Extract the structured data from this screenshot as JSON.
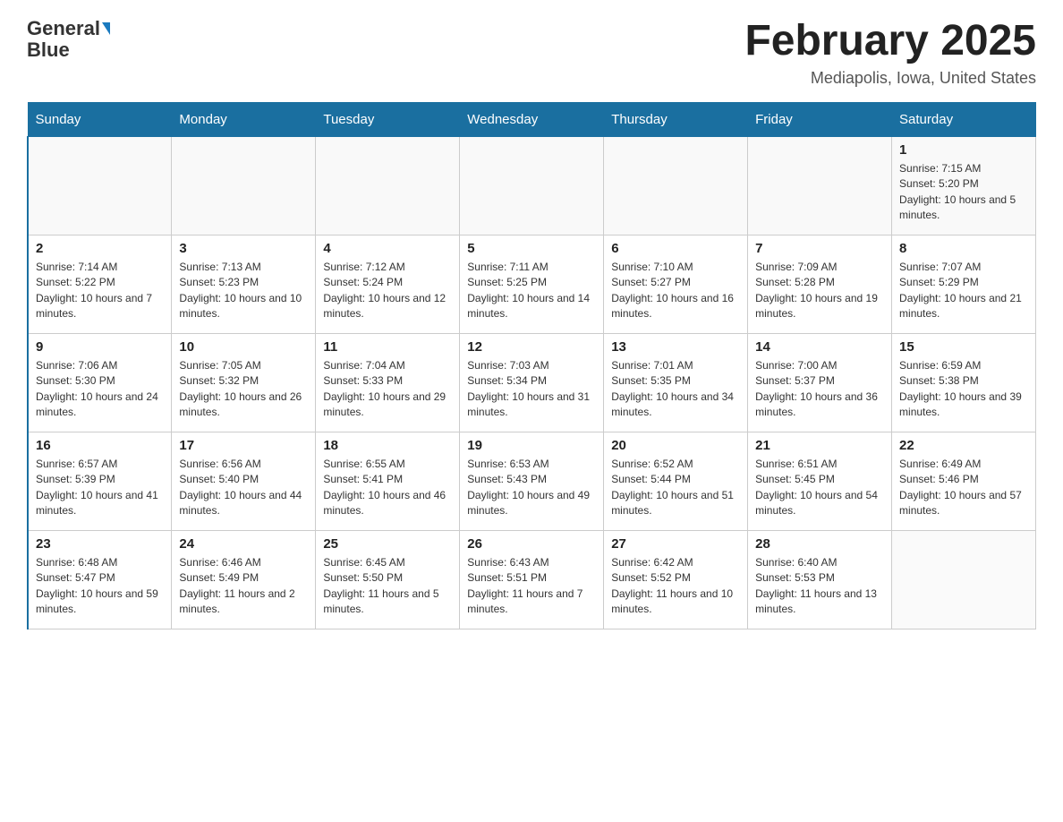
{
  "header": {
    "logo_line1": "General",
    "logo_line2": "Blue",
    "month_title": "February 2025",
    "location": "Mediapolis, Iowa, United States"
  },
  "days_of_week": [
    "Sunday",
    "Monday",
    "Tuesday",
    "Wednesday",
    "Thursday",
    "Friday",
    "Saturday"
  ],
  "weeks": [
    [
      {
        "day": "",
        "info": ""
      },
      {
        "day": "",
        "info": ""
      },
      {
        "day": "",
        "info": ""
      },
      {
        "day": "",
        "info": ""
      },
      {
        "day": "",
        "info": ""
      },
      {
        "day": "",
        "info": ""
      },
      {
        "day": "1",
        "info": "Sunrise: 7:15 AM\nSunset: 5:20 PM\nDaylight: 10 hours and 5 minutes."
      }
    ],
    [
      {
        "day": "2",
        "info": "Sunrise: 7:14 AM\nSunset: 5:22 PM\nDaylight: 10 hours and 7 minutes."
      },
      {
        "day": "3",
        "info": "Sunrise: 7:13 AM\nSunset: 5:23 PM\nDaylight: 10 hours and 10 minutes."
      },
      {
        "day": "4",
        "info": "Sunrise: 7:12 AM\nSunset: 5:24 PM\nDaylight: 10 hours and 12 minutes."
      },
      {
        "day": "5",
        "info": "Sunrise: 7:11 AM\nSunset: 5:25 PM\nDaylight: 10 hours and 14 minutes."
      },
      {
        "day": "6",
        "info": "Sunrise: 7:10 AM\nSunset: 5:27 PM\nDaylight: 10 hours and 16 minutes."
      },
      {
        "day": "7",
        "info": "Sunrise: 7:09 AM\nSunset: 5:28 PM\nDaylight: 10 hours and 19 minutes."
      },
      {
        "day": "8",
        "info": "Sunrise: 7:07 AM\nSunset: 5:29 PM\nDaylight: 10 hours and 21 minutes."
      }
    ],
    [
      {
        "day": "9",
        "info": "Sunrise: 7:06 AM\nSunset: 5:30 PM\nDaylight: 10 hours and 24 minutes."
      },
      {
        "day": "10",
        "info": "Sunrise: 7:05 AM\nSunset: 5:32 PM\nDaylight: 10 hours and 26 minutes."
      },
      {
        "day": "11",
        "info": "Sunrise: 7:04 AM\nSunset: 5:33 PM\nDaylight: 10 hours and 29 minutes."
      },
      {
        "day": "12",
        "info": "Sunrise: 7:03 AM\nSunset: 5:34 PM\nDaylight: 10 hours and 31 minutes."
      },
      {
        "day": "13",
        "info": "Sunrise: 7:01 AM\nSunset: 5:35 PM\nDaylight: 10 hours and 34 minutes."
      },
      {
        "day": "14",
        "info": "Sunrise: 7:00 AM\nSunset: 5:37 PM\nDaylight: 10 hours and 36 minutes."
      },
      {
        "day": "15",
        "info": "Sunrise: 6:59 AM\nSunset: 5:38 PM\nDaylight: 10 hours and 39 minutes."
      }
    ],
    [
      {
        "day": "16",
        "info": "Sunrise: 6:57 AM\nSunset: 5:39 PM\nDaylight: 10 hours and 41 minutes."
      },
      {
        "day": "17",
        "info": "Sunrise: 6:56 AM\nSunset: 5:40 PM\nDaylight: 10 hours and 44 minutes."
      },
      {
        "day": "18",
        "info": "Sunrise: 6:55 AM\nSunset: 5:41 PM\nDaylight: 10 hours and 46 minutes."
      },
      {
        "day": "19",
        "info": "Sunrise: 6:53 AM\nSunset: 5:43 PM\nDaylight: 10 hours and 49 minutes."
      },
      {
        "day": "20",
        "info": "Sunrise: 6:52 AM\nSunset: 5:44 PM\nDaylight: 10 hours and 51 minutes."
      },
      {
        "day": "21",
        "info": "Sunrise: 6:51 AM\nSunset: 5:45 PM\nDaylight: 10 hours and 54 minutes."
      },
      {
        "day": "22",
        "info": "Sunrise: 6:49 AM\nSunset: 5:46 PM\nDaylight: 10 hours and 57 minutes."
      }
    ],
    [
      {
        "day": "23",
        "info": "Sunrise: 6:48 AM\nSunset: 5:47 PM\nDaylight: 10 hours and 59 minutes."
      },
      {
        "day": "24",
        "info": "Sunrise: 6:46 AM\nSunset: 5:49 PM\nDaylight: 11 hours and 2 minutes."
      },
      {
        "day": "25",
        "info": "Sunrise: 6:45 AM\nSunset: 5:50 PM\nDaylight: 11 hours and 5 minutes."
      },
      {
        "day": "26",
        "info": "Sunrise: 6:43 AM\nSunset: 5:51 PM\nDaylight: 11 hours and 7 minutes."
      },
      {
        "day": "27",
        "info": "Sunrise: 6:42 AM\nSunset: 5:52 PM\nDaylight: 11 hours and 10 minutes."
      },
      {
        "day": "28",
        "info": "Sunrise: 6:40 AM\nSunset: 5:53 PM\nDaylight: 11 hours and 13 minutes."
      },
      {
        "day": "",
        "info": ""
      }
    ]
  ]
}
